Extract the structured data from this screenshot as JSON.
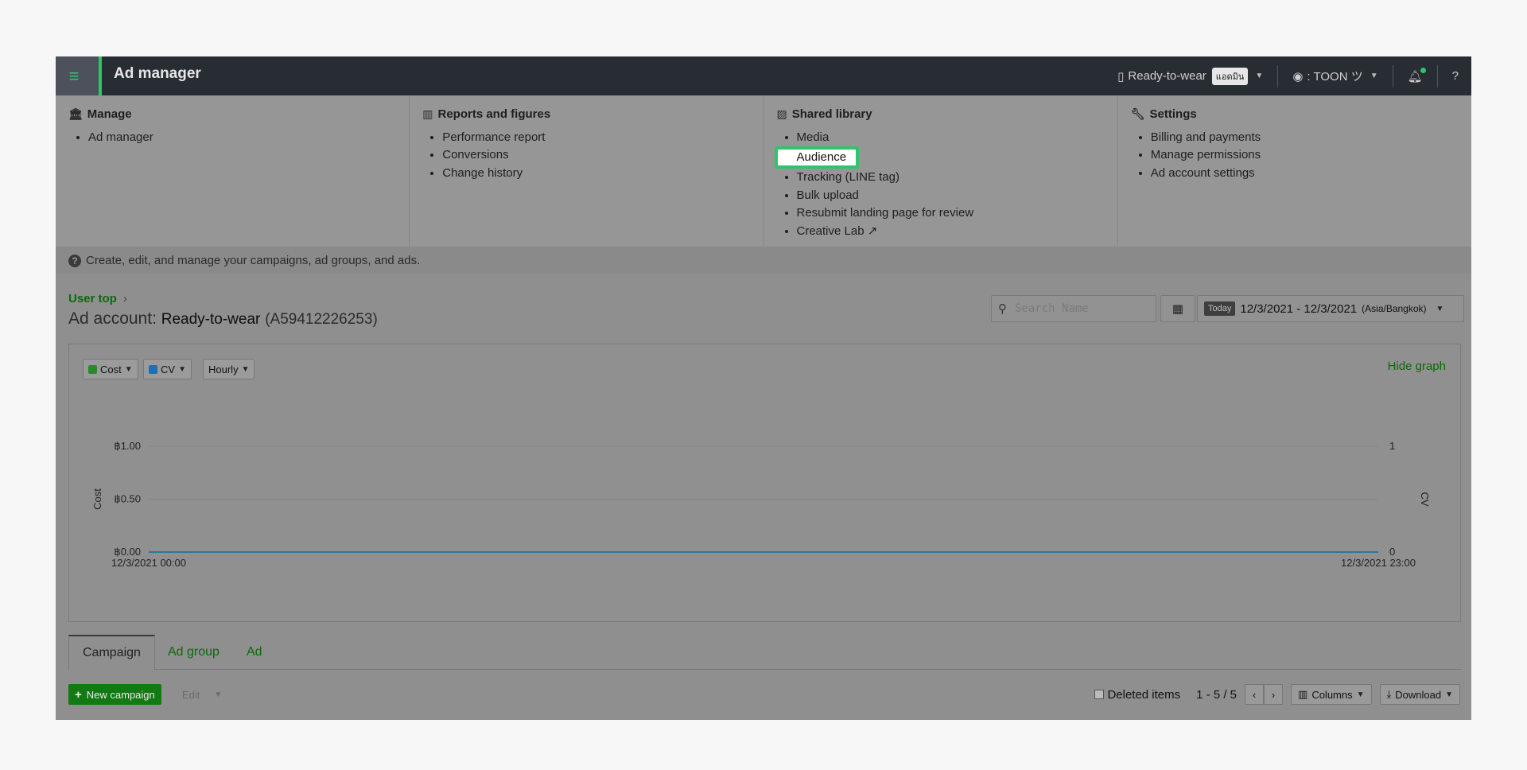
{
  "header": {
    "title": "Ad manager",
    "account": "Ready-to-wear",
    "account_badge": "แอดมิน",
    "user": ": TOON ツ",
    "icons": [
      "hamburger-icon",
      "building-icon",
      "user-circle-icon",
      "bell-icon",
      "help-icon"
    ]
  },
  "menu": {
    "manage": {
      "title": "Manage",
      "items": [
        "Ad manager"
      ]
    },
    "reports": {
      "title": "Reports and figures",
      "items": [
        "Performance report",
        "Conversions",
        "Change history"
      ]
    },
    "library": {
      "title": "Shared library",
      "items": [
        "Media",
        "Audience",
        "Tracking (LINE tag)",
        "Bulk upload",
        "Resubmit landing page for review",
        "Creative Lab"
      ]
    },
    "settings": {
      "title": "Settings",
      "items": [
        "Billing and payments",
        "Manage permissions",
        "Ad account settings"
      ]
    }
  },
  "help_text": "Create, edit, and manage your campaigns, ad groups, and ads.",
  "breadcrumb": {
    "link": "User top",
    "sep": "›"
  },
  "account_line": {
    "label": "Ad account:",
    "name": "Ready-to-wear",
    "id": "(A59412226253)"
  },
  "search": {
    "placeholder": "Search Name"
  },
  "date": {
    "today": "Today",
    "range": "12/3/2021 - 12/3/2021",
    "tz": "(Asia/Bangkok)"
  },
  "graph": {
    "metric1": "Cost",
    "metric2": "CV",
    "interval": "Hourly",
    "hide": "Hide graph",
    "colors": {
      "cost": "#2a8a2a",
      "cv": "#1f6fb3"
    }
  },
  "chart_data": {
    "type": "line",
    "x": [
      "12/3/2021 00:00",
      "12/3/2021 23:00"
    ],
    "series": [
      {
        "name": "Cost",
        "values": [
          0,
          0
        ]
      },
      {
        "name": "CV",
        "values": [
          0,
          0
        ]
      }
    ],
    "ylabel": "Cost",
    "y2label": "CV",
    "yticks": [
      "฿0.00",
      "฿0.50",
      "฿1.00"
    ],
    "y2ticks": [
      "0",
      "1"
    ],
    "ylim": [
      0,
      1
    ],
    "y2lim": [
      0,
      1
    ]
  },
  "tabs": [
    "Campaign",
    "Ad group",
    "Ad"
  ],
  "toolbar": {
    "new": "New campaign",
    "edit": "Edit",
    "deleted": "Deleted items",
    "pagination": "1 - 5 / 5",
    "columns": "Columns",
    "download": "Download"
  }
}
